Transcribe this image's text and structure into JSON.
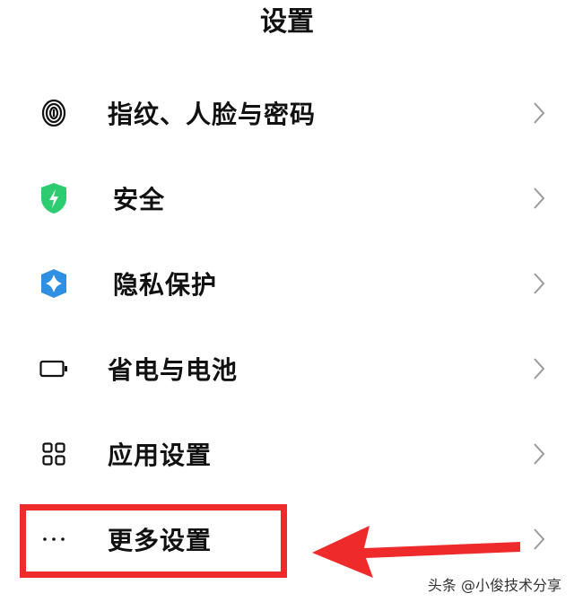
{
  "header": {
    "title": "设置"
  },
  "settings": {
    "items": [
      {
        "label": "指纹、人脸与密码",
        "icon": "fingerprint-icon"
      },
      {
        "label": "安全",
        "icon": "security-shield-icon",
        "color": "#2ecc71"
      },
      {
        "label": "隐私保护",
        "icon": "privacy-shield-icon",
        "color": "#2f8fe3"
      },
      {
        "label": "省电与电池",
        "icon": "battery-icon"
      },
      {
        "label": "应用设置",
        "icon": "app-grid-icon"
      },
      {
        "label": "更多设置",
        "icon": "more-dots-icon"
      }
    ]
  },
  "annotation": {
    "highlight_color": "#ee2a2a"
  },
  "watermark": {
    "text": "头条 @小俊技术分享"
  }
}
